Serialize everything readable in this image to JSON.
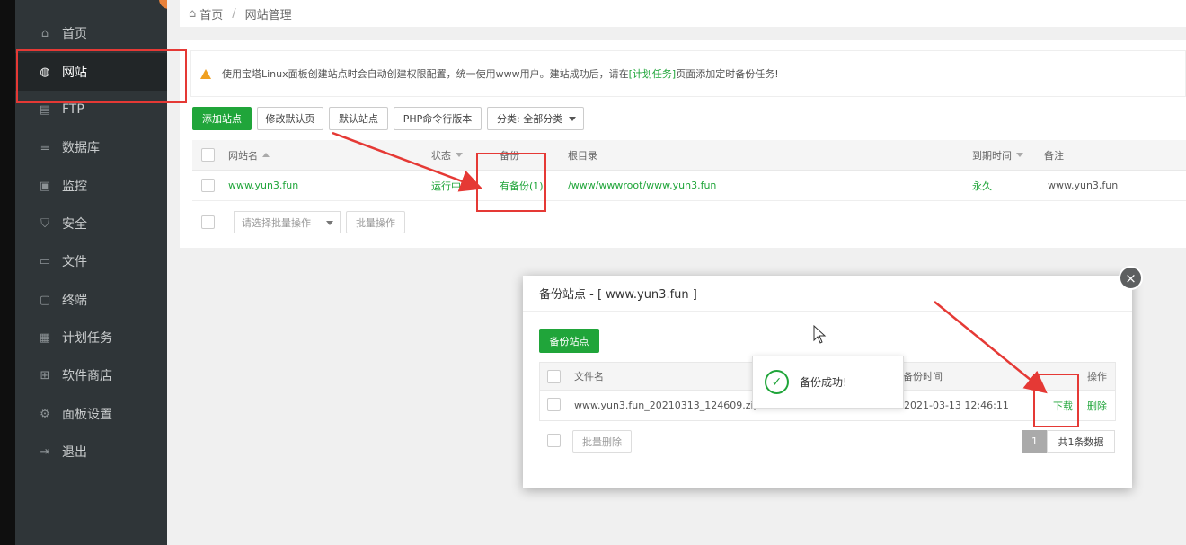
{
  "breadcrumb": {
    "home": "首页",
    "sep": "/",
    "current": "网站管理"
  },
  "sidebar": {
    "items": [
      {
        "label": "首页",
        "icon": "home-icon",
        "glyph": "⌂"
      },
      {
        "label": "网站",
        "icon": "globe-icon",
        "glyph": "◍"
      },
      {
        "label": "FTP",
        "icon": "server-icon",
        "glyph": "▤"
      },
      {
        "label": "数据库",
        "icon": "database-icon",
        "glyph": "≡"
      },
      {
        "label": "监控",
        "icon": "monitor-icon",
        "glyph": "▣"
      },
      {
        "label": "安全",
        "icon": "shield-icon",
        "glyph": "⛉"
      },
      {
        "label": "文件",
        "icon": "folder-icon",
        "glyph": "▭"
      },
      {
        "label": "终端",
        "icon": "terminal-icon",
        "glyph": "▢"
      },
      {
        "label": "计划任务",
        "icon": "calendar-icon",
        "glyph": "▦"
      },
      {
        "label": "软件商店",
        "icon": "apps-icon",
        "glyph": "⊞"
      },
      {
        "label": "面板设置",
        "icon": "gear-icon",
        "glyph": "⚙"
      },
      {
        "label": "退出",
        "icon": "logout-icon",
        "glyph": "⇥"
      }
    ]
  },
  "notice": {
    "before": "使用宝塔Linux面板创建站点时会自动创建权限配置，统一使用www用户。建站成功后，请在",
    "link": "[计划任务]",
    "after": "页面添加定时备份任务!"
  },
  "toolbar": {
    "add_site": "添加站点",
    "modify_default": "修改默认页",
    "default_site": "默认站点",
    "php_cli": "PHP命令行版本",
    "category": "分类: 全部分类"
  },
  "table": {
    "headers": {
      "name": "网站名",
      "status": "状态",
      "backup": "备份",
      "root": "根目录",
      "expire": "到期时间",
      "remark": "备注"
    },
    "rows": [
      {
        "name": "www.yun3.fun",
        "status": "运行中",
        "backup": "有备份(1)",
        "root": "/www/wwwroot/www.yun3.fun",
        "expire": "永久",
        "remark": "www.yun3.fun"
      }
    ]
  },
  "batch": {
    "placeholder": "请选择批量操作",
    "action": "批量操作"
  },
  "modal": {
    "title": "备份站点 - [ www.yun3.fun ]",
    "backup_button": "备份站点",
    "headers": {
      "filename": "文件名",
      "time": "备份时间",
      "ops": "操作"
    },
    "rows": [
      {
        "filename": "www.yun3.fun_20210313_124609.zip",
        "time": "2021-03-13 12:46:11",
        "download": "下载",
        "delete": "删除"
      }
    ],
    "batch_delete": "批量删除",
    "page": "1",
    "total": "共1条数据",
    "close": "×"
  },
  "toast": {
    "text": "备份成功!",
    "icon": "check-circle-icon",
    "glyph": "✓"
  },
  "colors": {
    "accent": "#20a53a",
    "annotation": "#e53935",
    "sidebar": "#2f3538"
  }
}
